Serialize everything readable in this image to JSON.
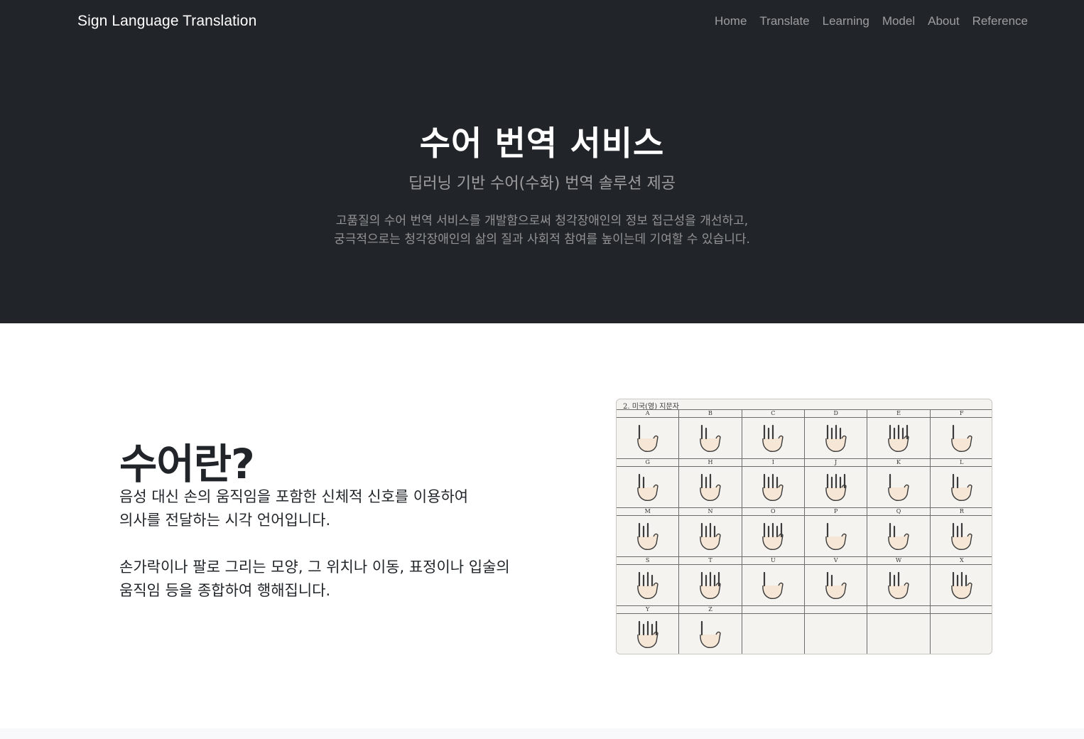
{
  "navbar": {
    "brand": "Sign Language Translation",
    "links": [
      "Home",
      "Translate",
      "Learning",
      "Model",
      "About",
      "Reference"
    ]
  },
  "hero": {
    "title": "수어 번역 서비스",
    "subtitle": "딥러닝 기반 수어(수화) 번역 솔루션 제공",
    "description_lines": [
      "고품질의 수어 번역 서비스를 개발함으로써 청각장애인의 정보 접근성을 개선하고,",
      "궁극적으로는 청각장애인의 삶의 질과 사회적 참여를 높이는데 기여할 수 있습니다."
    ]
  },
  "section": {
    "heading": "수어란?",
    "paragraph1": [
      "음성 대신 손의 움직임을 포함한 신체적 신호를 이용하여",
      "의사를 전달하는 시각 언어입니다."
    ],
    "paragraph2": [
      "손가락이나 팔로 그리는 모양, 그 위치나 이동, 표정이나 입술의",
      "움직임 등을 종합하여 행해집니다."
    ]
  },
  "fingerspelling_chart": {
    "caption": "2. 미국(영) 지문자",
    "letters": [
      "A",
      "B",
      "C",
      "D",
      "E",
      "F",
      "G",
      "H",
      "I",
      "J",
      "K",
      "L",
      "M",
      "N",
      "O",
      "P",
      "Q",
      "R",
      "S",
      "T",
      "U",
      "V",
      "W",
      "X",
      "Y",
      "Z",
      "",
      "",
      "",
      ""
    ]
  }
}
